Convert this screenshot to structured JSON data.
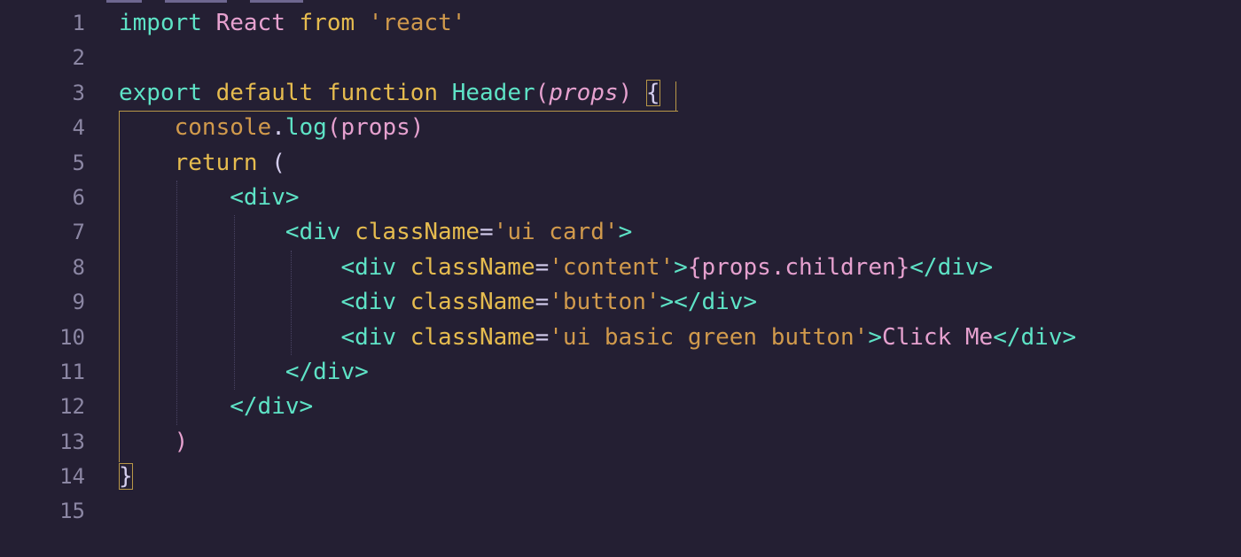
{
  "editor": {
    "language": "javascript-react",
    "colors": {
      "background": "#241f33",
      "line_number": "#8b86a3",
      "keyword": "#e6bc4f",
      "keyword_alt": "#5ee3c6",
      "string": "#d19a4c",
      "identifier": "#e6a1cf",
      "function": "#5ee3c6",
      "tag": "#5ee3c6",
      "attribute": "#e6bc4f",
      "bracket_match": "#b89748"
    },
    "line_numbers": [
      "1",
      "2",
      "3",
      "4",
      "5",
      "6",
      "7",
      "8",
      "9",
      "10",
      "11",
      "12",
      "13",
      "14",
      "15"
    ],
    "lines": [
      {
        "tokens": [
          [
            "kw2",
            "import"
          ],
          [
            "punc",
            " "
          ],
          [
            "ident",
            "React"
          ],
          [
            "punc",
            " "
          ],
          [
            "kw",
            "from"
          ],
          [
            "punc",
            " "
          ],
          [
            "str",
            "'react'"
          ]
        ]
      },
      {
        "tokens": []
      },
      {
        "tokens": [
          [
            "kw2",
            "export"
          ],
          [
            "punc",
            " "
          ],
          [
            "kw",
            "default"
          ],
          [
            "punc",
            " "
          ],
          [
            "kw",
            "function"
          ],
          [
            "punc",
            " "
          ],
          [
            "fn",
            "Header"
          ],
          [
            "paren",
            "("
          ],
          [
            "param",
            "props"
          ],
          [
            "paren",
            ")"
          ],
          [
            "punc",
            " "
          ],
          [
            "brace",
            "{"
          ]
        ]
      },
      {
        "tokens": [
          [
            "punc",
            "    "
          ],
          [
            "obj",
            "console"
          ],
          [
            "punc",
            "."
          ],
          [
            "fn",
            "log"
          ],
          [
            "paren",
            "("
          ],
          [
            "ident",
            "props"
          ],
          [
            "paren",
            ")"
          ]
        ]
      },
      {
        "tokens": [
          [
            "punc",
            "    "
          ],
          [
            "kw",
            "return"
          ],
          [
            "punc",
            " ("
          ]
        ]
      },
      {
        "tokens": [
          [
            "punc",
            "        "
          ],
          [
            "tag",
            "<div>"
          ]
        ]
      },
      {
        "tokens": [
          [
            "punc",
            "            "
          ],
          [
            "tag",
            "<div"
          ],
          [
            "punc",
            " "
          ],
          [
            "attr",
            "className"
          ],
          [
            "punc",
            "="
          ],
          [
            "str",
            "'ui card'"
          ],
          [
            "tag",
            ">"
          ]
        ]
      },
      {
        "tokens": [
          [
            "punc",
            "                "
          ],
          [
            "tag",
            "<div"
          ],
          [
            "punc",
            " "
          ],
          [
            "attr",
            "className"
          ],
          [
            "punc",
            "="
          ],
          [
            "str",
            "'content'"
          ],
          [
            "tag",
            ">"
          ],
          [
            "text",
            "{props.children}"
          ],
          [
            "tag",
            "</div>"
          ]
        ]
      },
      {
        "tokens": [
          [
            "punc",
            "                "
          ],
          [
            "tag",
            "<div"
          ],
          [
            "punc",
            " "
          ],
          [
            "attr",
            "className"
          ],
          [
            "punc",
            "="
          ],
          [
            "str",
            "'button'"
          ],
          [
            "tag",
            "></div>"
          ]
        ]
      },
      {
        "tokens": [
          [
            "punc",
            "                "
          ],
          [
            "tag",
            "<div"
          ],
          [
            "punc",
            " "
          ],
          [
            "attr",
            "className"
          ],
          [
            "punc",
            "="
          ],
          [
            "str",
            "'ui basic green button'"
          ],
          [
            "tag",
            ">"
          ],
          [
            "text",
            "Click Me"
          ],
          [
            "tag",
            "</div>"
          ]
        ]
      },
      {
        "tokens": [
          [
            "punc",
            "            "
          ],
          [
            "tag",
            "</div>"
          ]
        ]
      },
      {
        "tokens": [
          [
            "punc",
            "        "
          ],
          [
            "tag",
            "</div>"
          ]
        ]
      },
      {
        "tokens": [
          [
            "punc",
            "    "
          ],
          [
            "paren",
            ")"
          ]
        ]
      },
      {
        "tokens": [
          [
            "brace",
            "}"
          ]
        ]
      },
      {
        "tokens": []
      }
    ]
  }
}
